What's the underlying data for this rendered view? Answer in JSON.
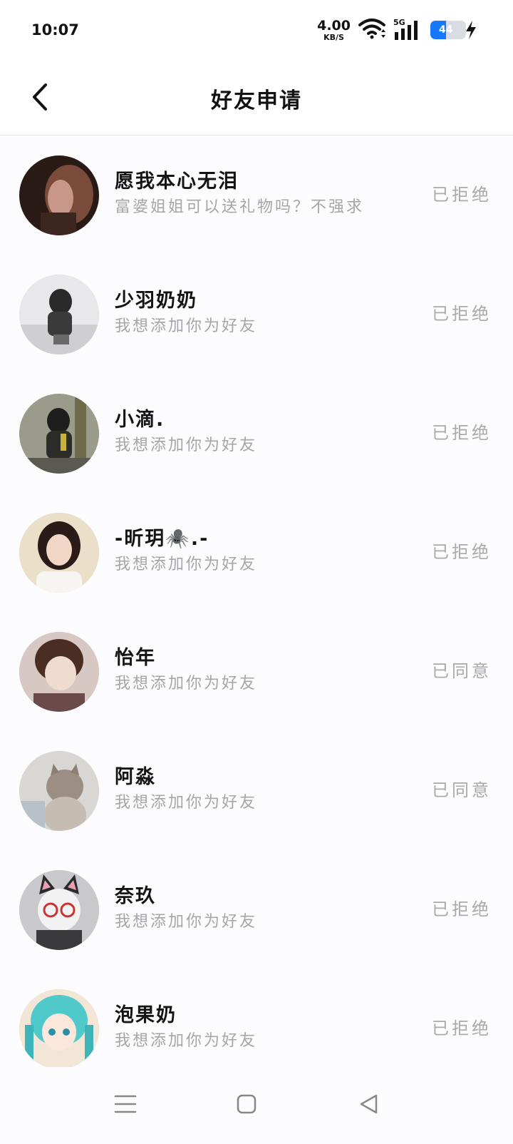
{
  "status_bar": {
    "time": "10:07",
    "net_speed_value": "4.00",
    "net_speed_unit": "KB/S",
    "network_type": "5G",
    "battery_level": "44",
    "battery_color": "#1677ff"
  },
  "header": {
    "title": "好友申请",
    "back_icon": "chevron-left-icon"
  },
  "requests": [
    {
      "name": "愿我本心无泪",
      "message": "富婆姐姐可以送礼物吗？不强求",
      "status": "已拒绝"
    },
    {
      "name": "少羽奶奶",
      "message": "我想添加你为好友",
      "status": "已拒绝"
    },
    {
      "name": "小滴.",
      "message": "我想添加你为好友",
      "status": "已拒绝"
    },
    {
      "name": "-昕玥🕷️.-",
      "message": "我想添加你为好友",
      "status": "已拒绝"
    },
    {
      "name": "怡年",
      "message": "我想添加你为好友",
      "status": "已同意"
    },
    {
      "name": "阿淼",
      "message": "我想添加你为好友",
      "status": "已同意"
    },
    {
      "name": "奈玖",
      "message": "我想添加你为好友",
      "status": "已拒绝"
    },
    {
      "name": "泡果奶",
      "message": "我想添加你为好友",
      "status": "已拒绝"
    }
  ],
  "nav_bar": {
    "menu_icon": "menu-icon",
    "home_icon": "home-square-icon",
    "back_icon": "back-triangle-icon"
  }
}
